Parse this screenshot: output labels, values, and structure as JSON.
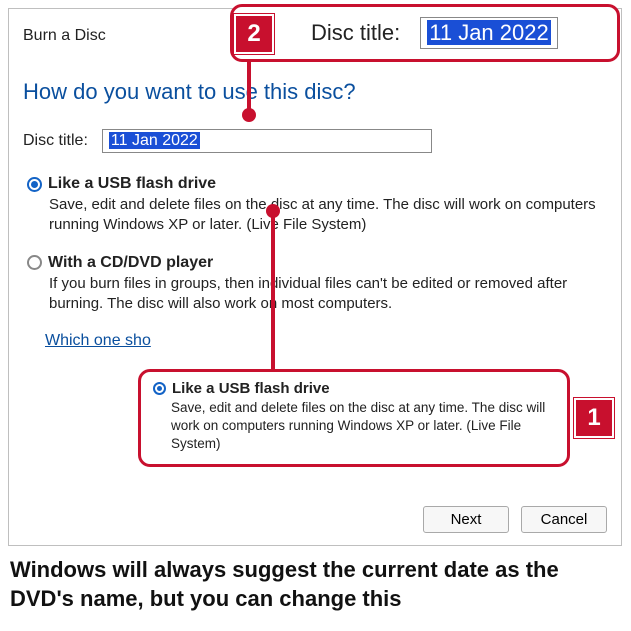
{
  "dialog": {
    "window_title": "Burn a Disc",
    "heading": "How do you want to use this disc?",
    "disc_title_label": "Disc title:",
    "disc_title_value": "11 Jan 2022",
    "link_text": "Which one sho",
    "buttons": {
      "next": "Next",
      "cancel": "Cancel"
    }
  },
  "options": {
    "usb": {
      "label": "Like a USB flash drive",
      "desc": "Save, edit and delete files on the disc at any time. The disc will work on computers running Windows XP or later. (Live File System)"
    },
    "cd": {
      "label": "With a CD/DVD player",
      "desc": "If you burn files in groups, then individual files can't be edited or removed after burning. The disc will also work on most computers."
    }
  },
  "callouts": {
    "top": {
      "marker": "2",
      "label": "Disc title:",
      "value": "11 Jan 2022"
    },
    "bottom": {
      "marker": "1",
      "label": "Like a USB flash drive",
      "desc": "Save, edit and delete files on the disc at any time. The disc will work on computers running Windows XP or later. (Live File System)"
    }
  },
  "caption": "Windows will always suggest the current date as the DVD's name, but you can change this"
}
